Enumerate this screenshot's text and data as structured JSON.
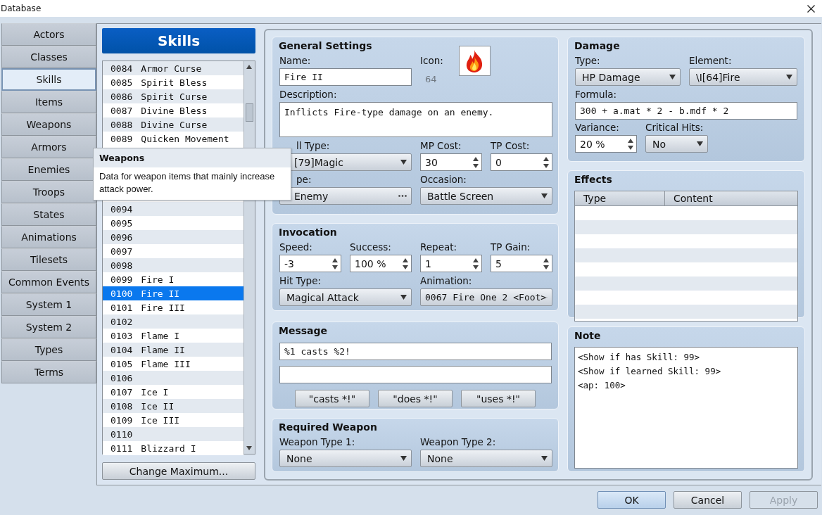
{
  "window": {
    "title": "Database"
  },
  "nav": [
    {
      "label": "Actors",
      "selected": false
    },
    {
      "label": "Classes",
      "selected": false
    },
    {
      "label": "Skills",
      "selected": true
    },
    {
      "label": "Items",
      "selected": false
    },
    {
      "label": "Weapons",
      "selected": false
    },
    {
      "label": "Armors",
      "selected": false
    },
    {
      "label": "Enemies",
      "selected": false
    },
    {
      "label": "Troops",
      "selected": false
    },
    {
      "label": "States",
      "selected": false
    },
    {
      "label": "Animations",
      "selected": false
    },
    {
      "label": "Tilesets",
      "selected": false
    },
    {
      "label": "Common Events",
      "selected": false
    },
    {
      "label": "System 1",
      "selected": false
    },
    {
      "label": "System 2",
      "selected": false
    },
    {
      "label": "Types",
      "selected": false
    },
    {
      "label": "Terms",
      "selected": false
    }
  ],
  "list": {
    "title": "Skills",
    "button": "Change Maximum...",
    "rows_before_tooltip": [
      {
        "number": "0084",
        "name": "Armor Curse",
        "selected": false
      },
      {
        "number": "0085",
        "name": "Spirit Bless",
        "selected": false
      },
      {
        "number": "0086",
        "name": "Spirit Curse",
        "selected": false
      },
      {
        "number": "0087",
        "name": "Divine Bless",
        "selected": false
      },
      {
        "number": "0088",
        "name": "Divine Curse",
        "selected": false
      },
      {
        "number": "0089",
        "name": "Quicken Movement",
        "selected": false
      }
    ],
    "rows_after_tooltip": [
      {
        "number": "0094",
        "selected": false
      },
      {
        "number": "0095",
        "selected": false
      },
      {
        "number": "0096",
        "selected": false
      },
      {
        "number": "0097",
        "selected": false
      },
      {
        "number": "0098",
        "selected": false
      },
      {
        "number": "0099",
        "name": "Fire I",
        "selected": false
      },
      {
        "number": "0100",
        "name": "Fire II",
        "selected": true
      },
      {
        "number": "0101",
        "name": "Fire III",
        "selected": false
      },
      {
        "number": "0102",
        "selected": false
      },
      {
        "number": "0103",
        "name": "Flame I",
        "selected": false
      },
      {
        "number": "0104",
        "name": "Flame II",
        "selected": false
      },
      {
        "number": "0105",
        "name": "Flame III",
        "selected": false
      },
      {
        "number": "0106",
        "selected": false
      },
      {
        "number": "0107",
        "name": "Ice I",
        "selected": false
      },
      {
        "number": "0108",
        "name": "Ice II",
        "selected": false
      },
      {
        "number": "0109",
        "name": "Ice III",
        "selected": false
      },
      {
        "number": "0110",
        "selected": false
      },
      {
        "number": "0111",
        "name": "Blizzard I",
        "selected": false
      }
    ]
  },
  "tooltip": {
    "title": "Weapons",
    "text": "Data for weapon items that mainly increase attack power."
  },
  "general": {
    "title": "General Settings",
    "name": {
      "label": "Name:",
      "value": "Fire II"
    },
    "icon": {
      "label": "Icon:",
      "index": "64"
    },
    "description": {
      "label": "Description:",
      "value": "Inflicts Fire-type damage on an enemy."
    },
    "skill_type": {
      "label": "ll Type:",
      "value": "[79]Magic"
    },
    "mp_cost": {
      "label": "MP Cost:",
      "value": "30"
    },
    "tp_cost": {
      "label": "TP Cost:",
      "value": "0"
    },
    "scope": {
      "label": "pe:",
      "value": "Enemy"
    },
    "occasion": {
      "label": "Occasion:",
      "value": "Battle Screen"
    }
  },
  "invocation": {
    "title": "Invocation",
    "speed": {
      "label": "Speed:",
      "value": "-3"
    },
    "success": {
      "label": "Success:",
      "value": "100 %"
    },
    "repeat": {
      "label": "Repeat:",
      "value": "1"
    },
    "tp_gain": {
      "label": "TP Gain:",
      "value": "5"
    },
    "hit_type": {
      "label": "Hit Type:",
      "value": "Magical Attack"
    },
    "animation": {
      "label": "Animation:",
      "value": "0067 Fire One 2 <Foot>"
    }
  },
  "message": {
    "title": "Message",
    "line_1": "%1 casts %2!",
    "buttons": [
      "\"casts *!\"",
      "\"does *!\"",
      "\"uses *!\""
    ]
  },
  "required_weapon": {
    "title": "Required Weapon",
    "weapon_type_1": {
      "label": "Weapon Type 1:",
      "value": "None"
    },
    "weapon_type_2": {
      "label": "Weapon Type 2:",
      "value": "None"
    }
  },
  "damage": {
    "title": "Damage",
    "type": {
      "label": "Type:",
      "value": "HP Damage"
    },
    "element": {
      "label": "Element:",
      "value": "\\I[64]Fire"
    },
    "formula": {
      "label": "Formula:",
      "value": "300 + a.mat * 2 - b.mdf * 2"
    },
    "variance": {
      "label": "Variance:",
      "value": "20 %"
    },
    "critical_hits": {
      "label": "Critical Hits:",
      "value": "No"
    }
  },
  "effects": {
    "title": "Effects",
    "columns": [
      "Type",
      "Content"
    ]
  },
  "note": {
    "title": "Note",
    "lines": [
      "<Show if has Skill: 99>",
      "<Show if learned Skill: 99>",
      "<ap: 100>"
    ]
  },
  "buttons": [
    {
      "label": "OK",
      "default": true,
      "disabled": false
    },
    {
      "label": "Cancel",
      "default": false,
      "disabled": false
    },
    {
      "label": "Apply",
      "default": false,
      "disabled": true
    }
  ]
}
